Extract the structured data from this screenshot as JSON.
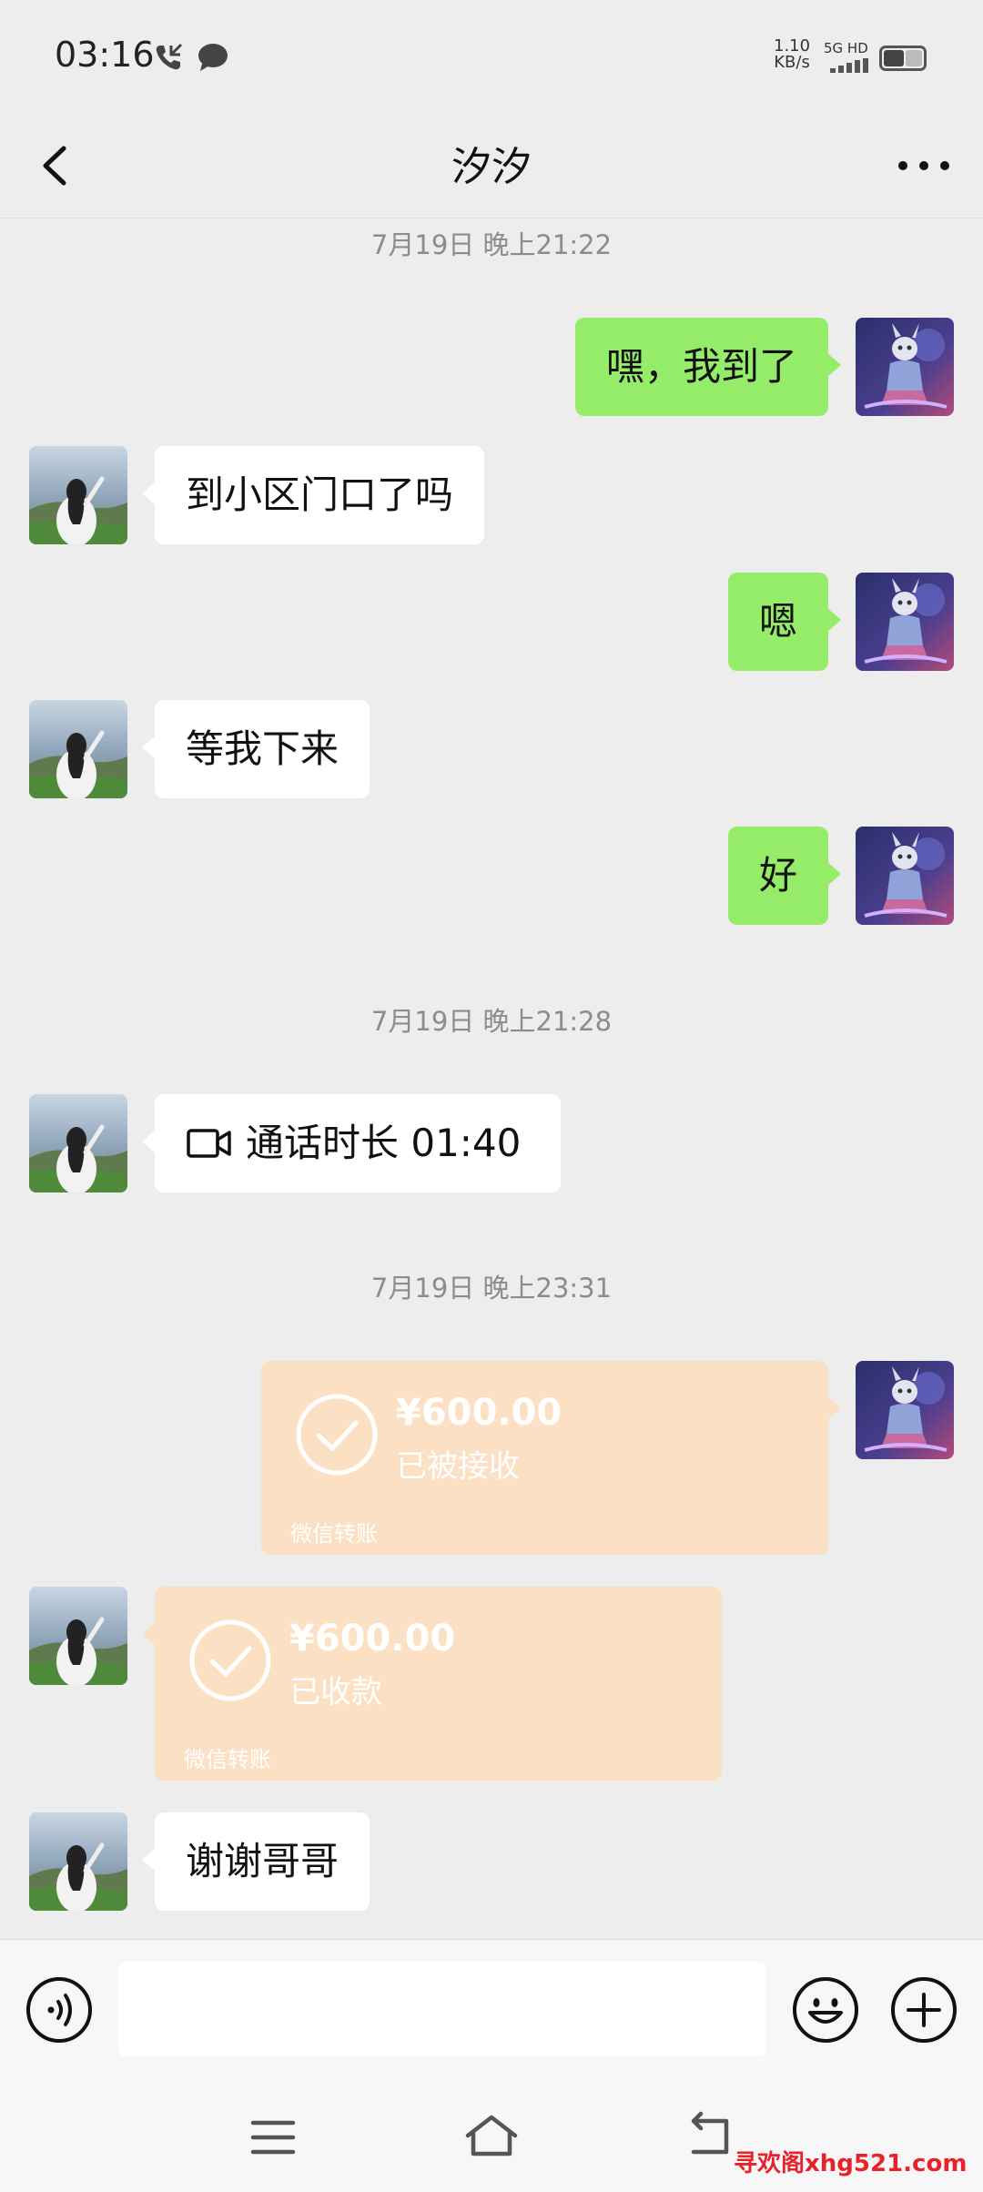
{
  "status_bar": {
    "time": "03:16",
    "speed_value": "1.10",
    "speed_unit": "KB/s",
    "network": "5G HD"
  },
  "header": {
    "title": "汐汐"
  },
  "messages": {
    "ts1": "7月19日 晚上21:22",
    "m1": "嘿，我到了",
    "m2": "到小区门口了吗",
    "m3": "嗯",
    "m4": "等我下来",
    "m5": "好",
    "ts2": "7月19日 晚上21:28",
    "call": "通话时长 01:40",
    "ts3": "7月19日 晚上23:31",
    "transfer1": {
      "amount": "¥600.00",
      "status": "已被接收",
      "label": "微信转账"
    },
    "transfer2": {
      "amount": "¥600.00",
      "status": "已收款",
      "label": "微信转账"
    },
    "m6": "谢谢哥哥"
  },
  "watermark": "寻欢阁xhg521.com",
  "colors": {
    "my_bubble": "#95ec69",
    "other_bubble": "#ffffff",
    "transfer": "#fbe0c3",
    "background": "#ededed"
  },
  "icons": [
    "back-arrow-icon",
    "more-icon",
    "video-call-icon",
    "check-circle-icon",
    "voice-icon",
    "emoji-icon",
    "plus-icon",
    "menu-icon",
    "home-icon",
    "return-icon"
  ]
}
